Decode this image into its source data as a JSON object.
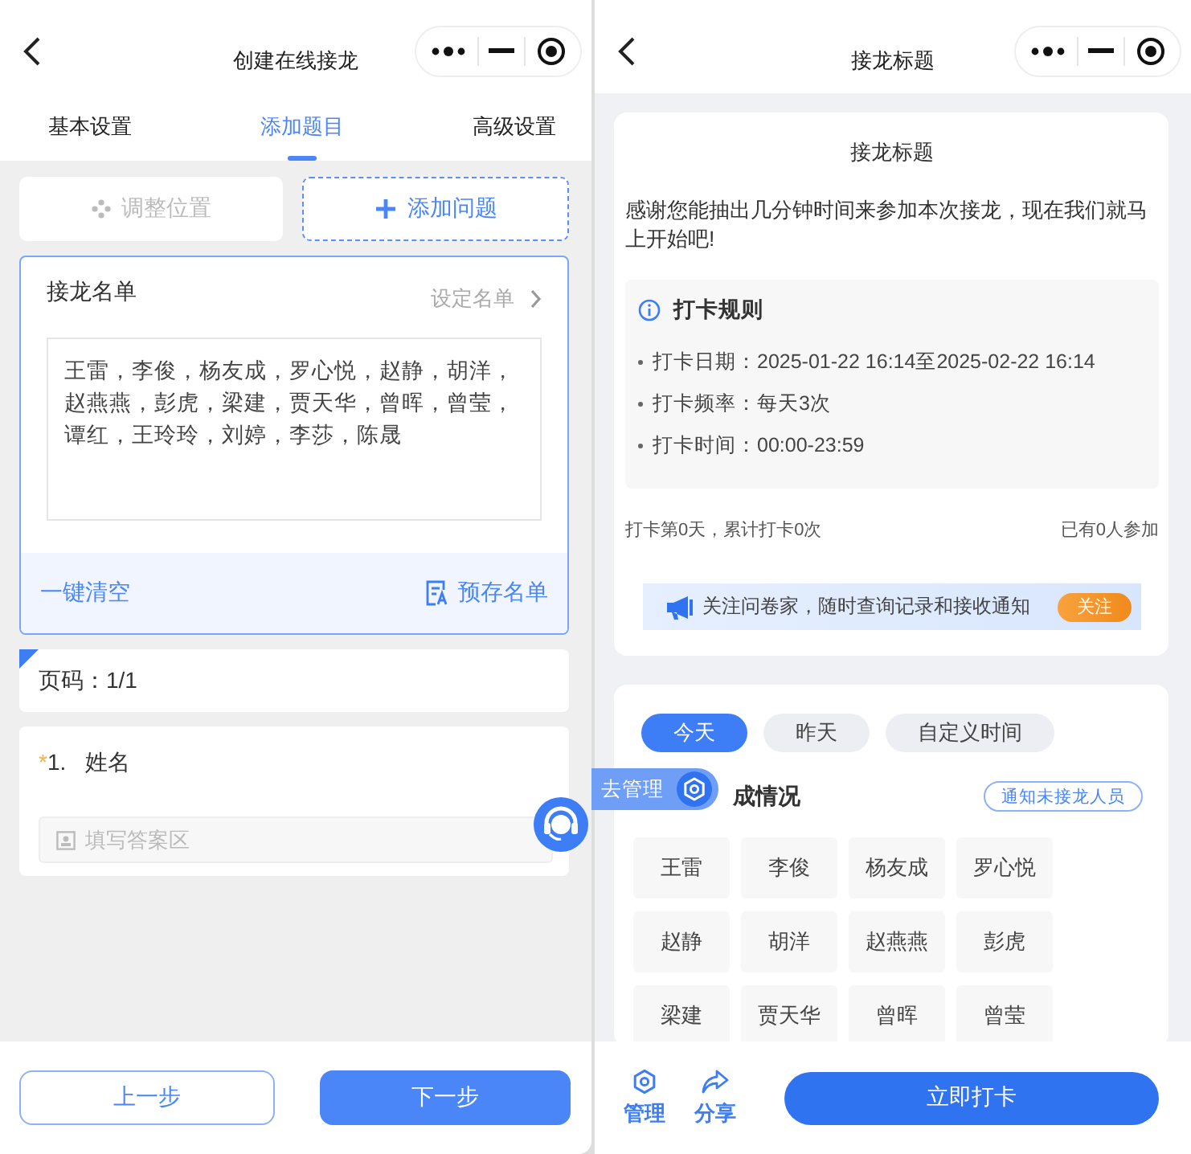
{
  "left": {
    "nav_title": "创建在线接龙",
    "tabs": [
      {
        "label": "基本设置",
        "selected": false
      },
      {
        "label": "添加题目",
        "selected": true
      },
      {
        "label": "高级设置",
        "selected": false
      }
    ],
    "toolbar": [
      {
        "kind": "move",
        "label": "调整位置",
        "disabled": true
      },
      {
        "kind": "add",
        "label": "添加问题",
        "disabled": false
      }
    ],
    "roster": {
      "title": "接龙名单",
      "link": "设定名单",
      "names": "王雷，李俊，杨友成，罗心悦，赵静，胡洋，赵燕燕，彭虎，梁建，贾天华，曾晖，曾莹，谭红，王玲玲，刘婷，李莎，陈晟",
      "clear": "一键清空",
      "save": "预存名单"
    },
    "page_indicator": "页码：1/1",
    "question": {
      "required_mark": "*",
      "number": "1.",
      "title": "姓名",
      "placeholder": "填写答案区"
    },
    "prev": "上一步",
    "next": "下一步"
  },
  "right": {
    "nav_title": "接龙标题",
    "title": "接龙标题",
    "intro": "感谢您能抽出几分钟时间来参加本次接龙，现在我们就马上开始吧!",
    "rules": {
      "title": "打卡规则",
      "items": [
        "打卡日期：2025-01-22 16:14至2025-02-22 16:14",
        "打卡频率：每天3次",
        "打卡时间：00:00-23:59"
      ]
    },
    "stats_left": "打卡第0天，累计打卡0次",
    "stats_right": "已有0人参加",
    "follow": {
      "text": "关注问卷家，随时查询记录和接收通知",
      "button": "关注"
    },
    "date_tabs": [
      {
        "label": "今天",
        "selected": true
      },
      {
        "label": "昨天",
        "selected": false
      },
      {
        "label": "自定义时间",
        "selected": false
      }
    ],
    "section_title": "成情况",
    "notify": "通知未接龙人员",
    "names": [
      "王雷",
      "李俊",
      "杨友成",
      "罗心悦",
      "赵静",
      "胡洋",
      "赵燕燕",
      "彭虎",
      "梁建",
      "贾天华",
      "曾晖",
      "曾莹"
    ],
    "actions": [
      {
        "kind": "gear",
        "label": "管理"
      },
      {
        "kind": "share",
        "label": "分享"
      }
    ],
    "primary": "立即打卡"
  },
  "manage_badge": "去管理"
}
